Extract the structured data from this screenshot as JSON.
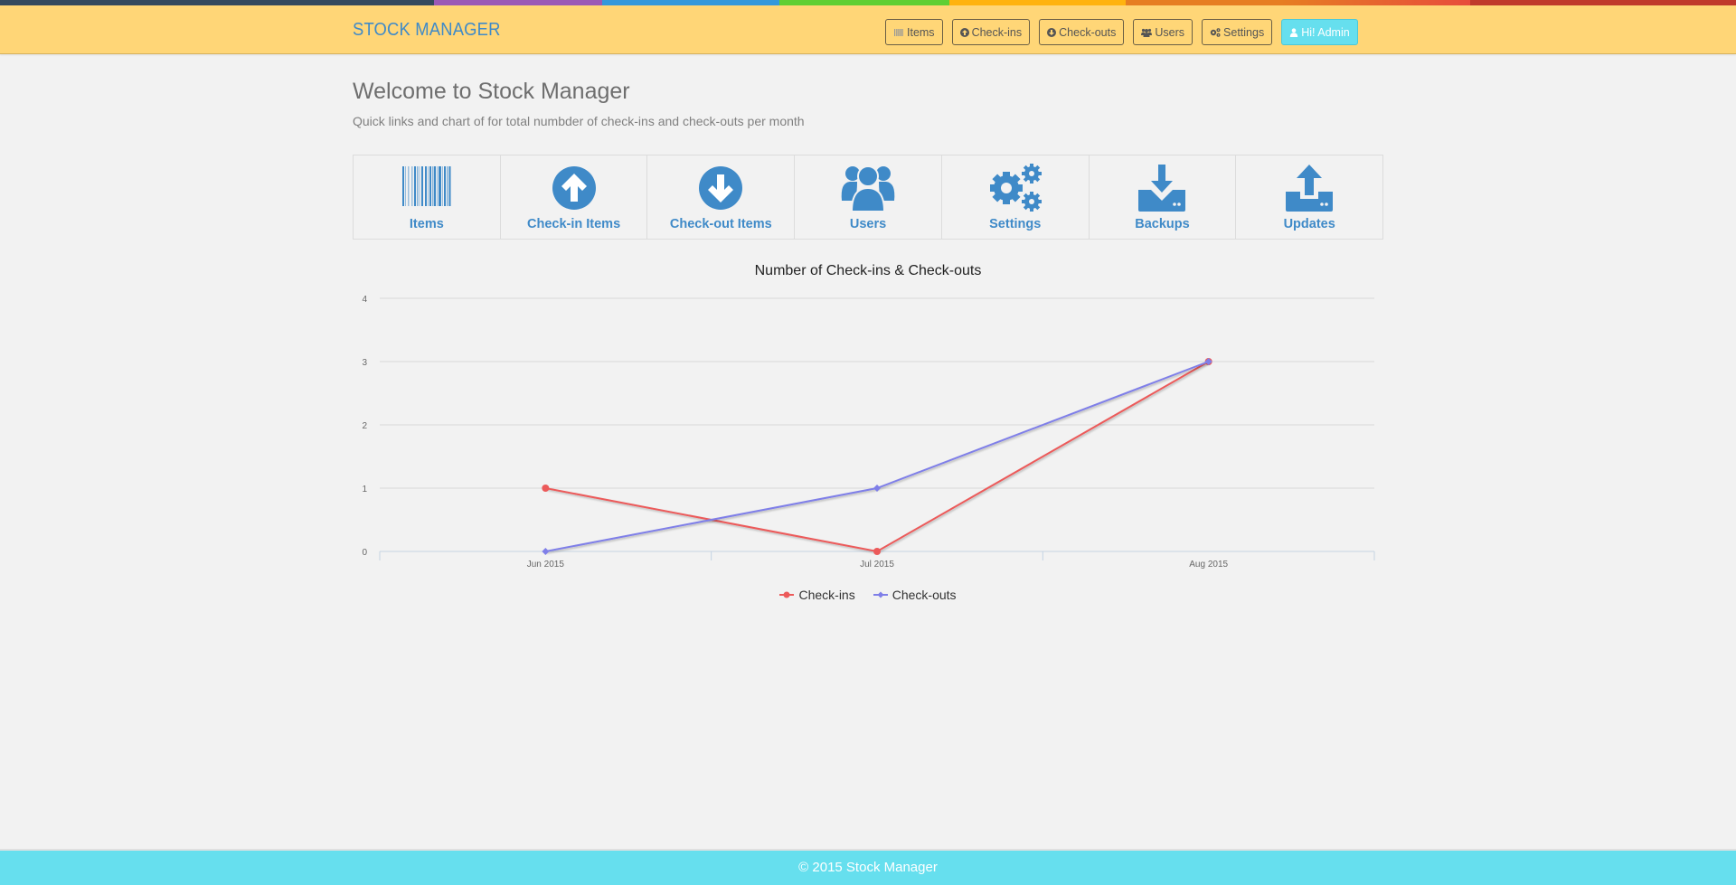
{
  "stripe_colors": [
    "#34495e",
    "#9b59b6",
    "#3498db",
    "#5fcf33",
    "#ffb30f",
    "#e67e22",
    "#e74c3c",
    "#c0392b"
  ],
  "navbar": {
    "brand": "STOCK MANAGER",
    "buttons": [
      {
        "label": "Items",
        "icon": "barcode-icon"
      },
      {
        "label": "Check-ins",
        "icon": "arrow-circle-up-icon"
      },
      {
        "label": "Check-outs",
        "icon": "arrow-circle-down-icon"
      },
      {
        "label": "Users",
        "icon": "users-icon"
      },
      {
        "label": "Settings",
        "icon": "cogs-icon"
      },
      {
        "label": "Hi! Admin",
        "icon": "user-icon"
      }
    ]
  },
  "page": {
    "title": "Welcome to Stock Manager",
    "subtitle": "Quick links and chart of for total numbder of check-ins and check-outs per month"
  },
  "quicklinks": [
    {
      "label": "Items",
      "icon": "barcode-icon"
    },
    {
      "label": "Check-in Items",
      "icon": "arrow-circle-up-icon"
    },
    {
      "label": "Check-out Items",
      "icon": "arrow-circle-down-icon"
    },
    {
      "label": "Users",
      "icon": "users-icon"
    },
    {
      "label": "Settings",
      "icon": "cogs-icon"
    },
    {
      "label": "Backups",
      "icon": "download-icon"
    },
    {
      "label": "Updates",
      "icon": "upload-icon"
    }
  ],
  "colors": {
    "accent": "#3f8ac8",
    "navbar_bg": "#ffd677",
    "admin_btn": "#66dfee",
    "footer_bg": "#66dfee"
  },
  "chart_data": {
    "type": "line",
    "title": "Number of Check-ins & Check-outs",
    "categories": [
      "Jun 2015",
      "Jul 2015",
      "Aug 2015"
    ],
    "series": [
      {
        "name": "Check-ins",
        "values": [
          1,
          0,
          3
        ],
        "color": "#ec5a5a",
        "marker": "circle"
      },
      {
        "name": "Check-outs",
        "values": [
          0,
          1,
          3
        ],
        "color": "#7f7fe8",
        "marker": "diamond"
      }
    ],
    "yticks": [
      0,
      1,
      2,
      3,
      4
    ],
    "ylim": [
      0,
      4
    ],
    "xlabel": "",
    "ylabel": "",
    "grid": true,
    "legend": "bottom-center"
  },
  "footer": {
    "text": "© 2015 Stock Manager"
  }
}
